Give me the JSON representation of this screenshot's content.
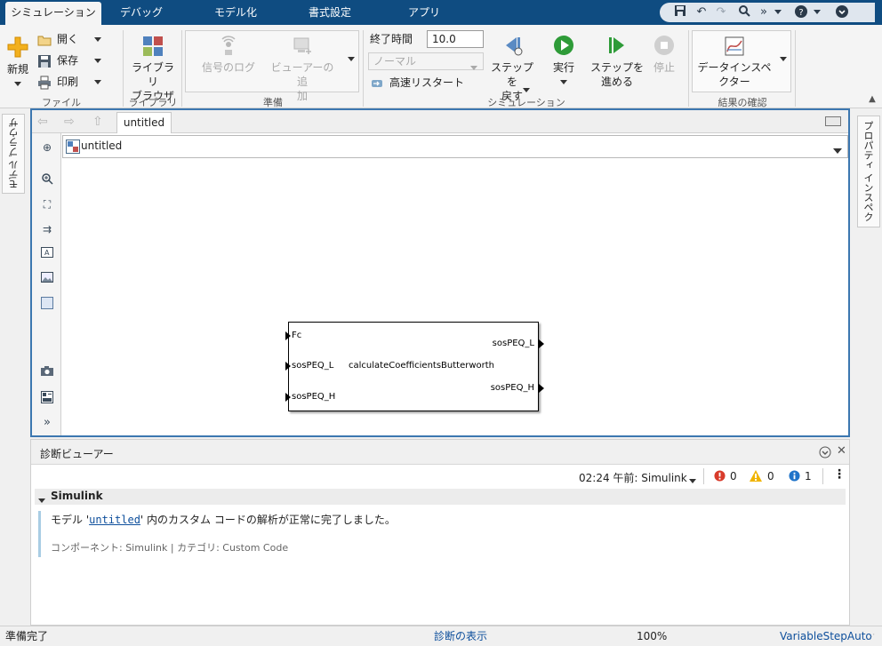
{
  "tabs": [
    {
      "label": "シミュレーション",
      "active": true
    },
    {
      "label": "デバッグ"
    },
    {
      "label": "モデル化"
    },
    {
      "label": "書式設定"
    },
    {
      "label": "アプリ"
    }
  ],
  "file_group": {
    "new_label": "新規",
    "open_label": "開く",
    "save_label": "保存",
    "print_label": "印刷",
    "group_label": "ファイル"
  },
  "library_group": {
    "browser_label_1": "ライブラリ",
    "browser_label_2": "ブラウザー",
    "group_label": "ライブラリ"
  },
  "prepare_group": {
    "signal_log_label": "信号のログ",
    "add_viewer_label_1": "ビューアーの追",
    "add_viewer_label_2": "加",
    "group_label": "準備"
  },
  "simulation_group": {
    "stop_time_label": "終了時間",
    "stop_time_value": "10.0",
    "mode_value": "ノーマル",
    "fast_restart_label": "高速リスタート",
    "step_back_label_1": "ステップを",
    "step_back_label_2": "戻す",
    "run_label": "実行",
    "step_forward_label_1": "ステップを",
    "step_forward_label_2": "進める",
    "stop_label": "停止",
    "group_label": "シミュレーション"
  },
  "results_group": {
    "data_inspector_label_1": "データインスペ",
    "data_inspector_label_2": "クター",
    "group_label": "結果の確認"
  },
  "side_tabs": {
    "model_browser": "モデル ブラウザー",
    "property_inspector": "プロパティ インスペクター"
  },
  "editor": {
    "doc_tab": "untitled",
    "address": "untitled"
  },
  "block": {
    "name": "calculateCoefficientsButterworth",
    "inputs": [
      "Fc",
      "sosPEQ_L",
      "sosPEQ_H"
    ],
    "outputs": [
      "sosPEQ_L",
      "sosPEQ_H"
    ]
  },
  "diagnostics": {
    "title": "診断ビューアー",
    "timestamp": "02:24 午前: Simulink",
    "errors": "0",
    "warnings": "0",
    "infos": "1",
    "section": "Simulink",
    "message_prefix": "モデル '",
    "message_link": "untitled",
    "message_suffix": "' 内のカスタム コードの解析が正常に完了しました。",
    "component": "コンポーネント: Simulink | カテゴリ: Custom Code"
  },
  "status": {
    "left": "準備完了",
    "center": "診断の表示",
    "zoom": "100%",
    "solver": "VariableStepAuto"
  },
  "colors": {
    "ribbon_blue": "#0f4c81",
    "editor_border": "#3c77b0",
    "run_green": "#2e9b38",
    "link_blue": "#0e4f9c"
  }
}
